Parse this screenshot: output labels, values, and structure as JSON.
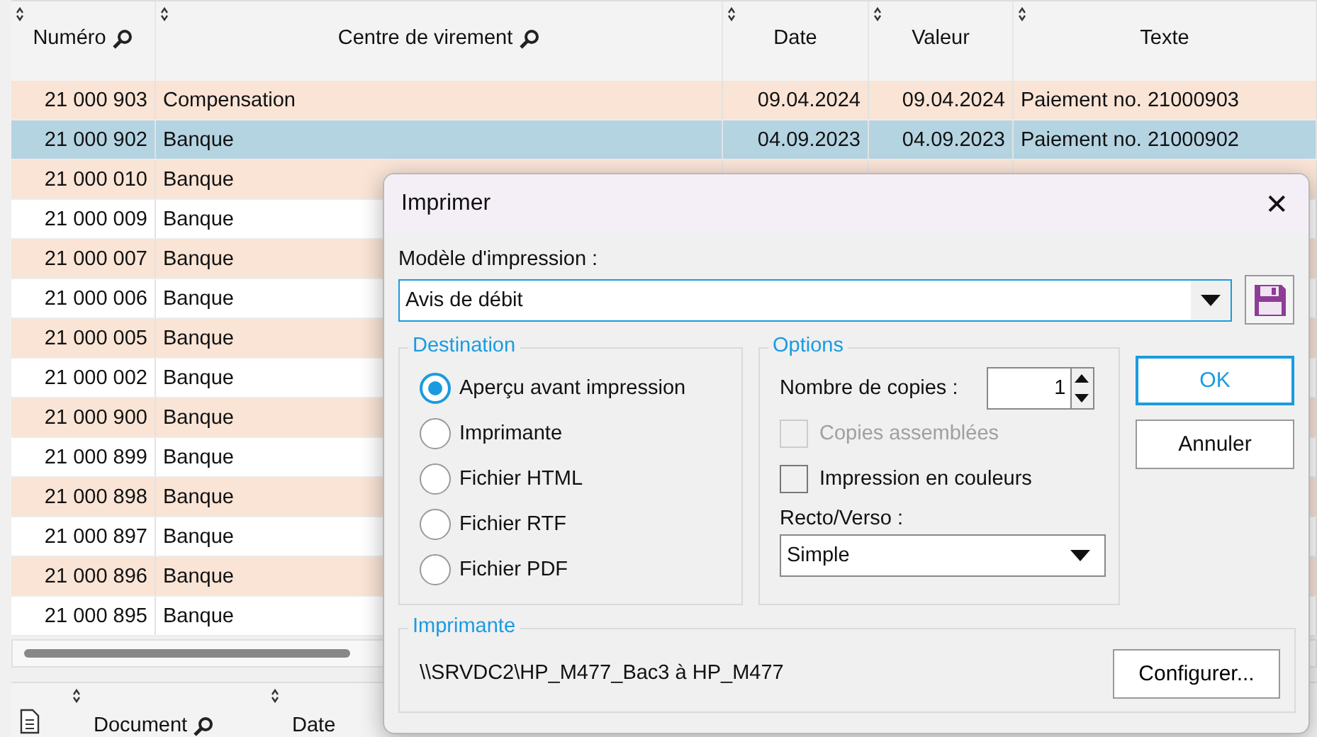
{
  "table": {
    "columns": [
      {
        "label": "Numéro",
        "search": true
      },
      {
        "label": "Centre de virement",
        "search": true
      },
      {
        "label": "Date",
        "search": false
      },
      {
        "label": "Valeur",
        "search": false
      },
      {
        "label": "Texte",
        "search": false
      }
    ],
    "rows": [
      {
        "cells": [
          "21 000 903",
          "Compensation",
          "09.04.2024",
          "09.04.2024",
          "Paiement no. 21000903"
        ],
        "selected": false
      },
      {
        "cells": [
          "21 000 902",
          "Banque",
          "04.09.2023",
          "04.09.2023",
          "Paiement no. 21000902"
        ],
        "selected": true
      },
      {
        "cells": [
          "21 000 010",
          "Banque"
        ],
        "selected": false
      },
      {
        "cells": [
          "21 000 009",
          "Banque"
        ],
        "selected": false
      },
      {
        "cells": [
          "21 000 007",
          "Banque"
        ],
        "selected": false
      },
      {
        "cells": [
          "21 000 006",
          "Banque"
        ],
        "selected": false
      },
      {
        "cells": [
          "21 000 005",
          "Banque"
        ],
        "selected": false
      },
      {
        "cells": [
          "21 000 002",
          "Banque"
        ],
        "selected": false
      },
      {
        "cells": [
          "21 000 900",
          "Banque"
        ],
        "selected": false
      },
      {
        "cells": [
          "21 000 899",
          "Banque"
        ],
        "selected": false
      },
      {
        "cells": [
          "21 000 898",
          "Banque"
        ],
        "selected": false
      },
      {
        "cells": [
          "21 000 897",
          "Banque"
        ],
        "selected": false
      },
      {
        "cells": [
          "21 000 896",
          "Banque"
        ],
        "selected": false
      },
      {
        "cells": [
          "21 000 895",
          "Banque"
        ],
        "selected": false
      }
    ]
  },
  "bottom_table": {
    "columns": [
      {
        "label": "Document",
        "search": true
      },
      {
        "label": "Date",
        "search": false
      }
    ]
  },
  "dialog": {
    "title": "Imprimer",
    "close": "✕",
    "template_label": "Modèle d'impression :",
    "template_value": "Avis de débit",
    "destination": {
      "title": "Destination",
      "options": [
        {
          "label": "Aperçu avant impression",
          "selected": true
        },
        {
          "label": "Imprimante",
          "selected": false
        },
        {
          "label": "Fichier HTML",
          "selected": false
        },
        {
          "label": "Fichier RTF",
          "selected": false
        },
        {
          "label": "Fichier PDF",
          "selected": false
        }
      ]
    },
    "options": {
      "title": "Options",
      "copies_label": "Nombre de copies :",
      "copies_value": "1",
      "checkboxes": [
        {
          "label": "Copies assemblées",
          "checked": false,
          "disabled": true
        },
        {
          "label": "Impression en couleurs",
          "checked": false,
          "disabled": false
        }
      ],
      "duplex_label": "Recto/Verso :",
      "duplex_value": "Simple"
    },
    "buttons": [
      {
        "label": "OK",
        "default": true
      },
      {
        "label": "Annuler",
        "default": false
      }
    ],
    "printer": {
      "title": "Imprimante",
      "value": "\\\\SRVDC2\\HP_M477_Bac3 à HP_M477",
      "button": "Configurer..."
    }
  }
}
